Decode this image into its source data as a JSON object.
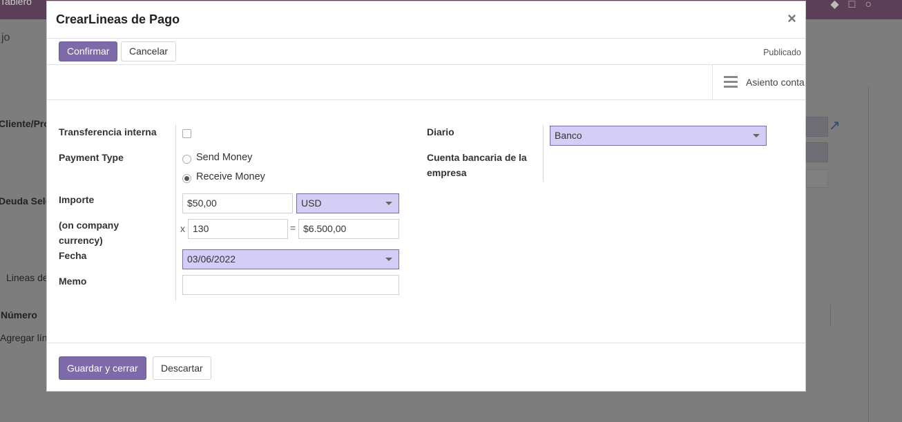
{
  "background": {
    "top_menu": "Tablero",
    "page_title_fragment": "jo",
    "field_cliente": "Cliente/Pro",
    "field_deuda": "Deuda Sele",
    "lines_label": "Lineas de",
    "numero_header": "Número",
    "add_line": "Agregar lín"
  },
  "modal": {
    "title": "CrearLineas de Pago",
    "close_glyph": "×",
    "actions": {
      "confirm": "Confirmar",
      "cancel": "Cancelar"
    },
    "status": "Publicado",
    "smart_button": {
      "icon": "list-icon",
      "label": "Asiento conta"
    },
    "form": {
      "internal_transfer": {
        "label": "Transferencia interna",
        "checked": false
      },
      "payment_type": {
        "label": "Payment Type",
        "options": [
          {
            "label": "Send Money",
            "selected": false
          },
          {
            "label": "Receive Money",
            "selected": true
          }
        ]
      },
      "amount": {
        "label": "Importe",
        "value": "$50,00",
        "currency": "USD"
      },
      "company_currency": {
        "label": "(on company currency)",
        "multiply_symbol": "x",
        "rate": "130",
        "equals_symbol": "=",
        "result": "$6.500,00"
      },
      "date": {
        "label": "Fecha",
        "value": "03/06/2022"
      },
      "memo": {
        "label": "Memo",
        "value": ""
      },
      "journal": {
        "label": "Diario",
        "value": "Banco"
      },
      "company_bank_account": {
        "label": "Cuenta bancaria de la empresa",
        "value": ""
      }
    },
    "footer": {
      "save_close": "Guardar y cerrar",
      "discard": "Descartar"
    }
  },
  "colors": {
    "primary": "#7c6ba8",
    "select_bg": "#d4cdf5",
    "topbar": "#5b3f56",
    "overlay": "#7d7d7d"
  }
}
